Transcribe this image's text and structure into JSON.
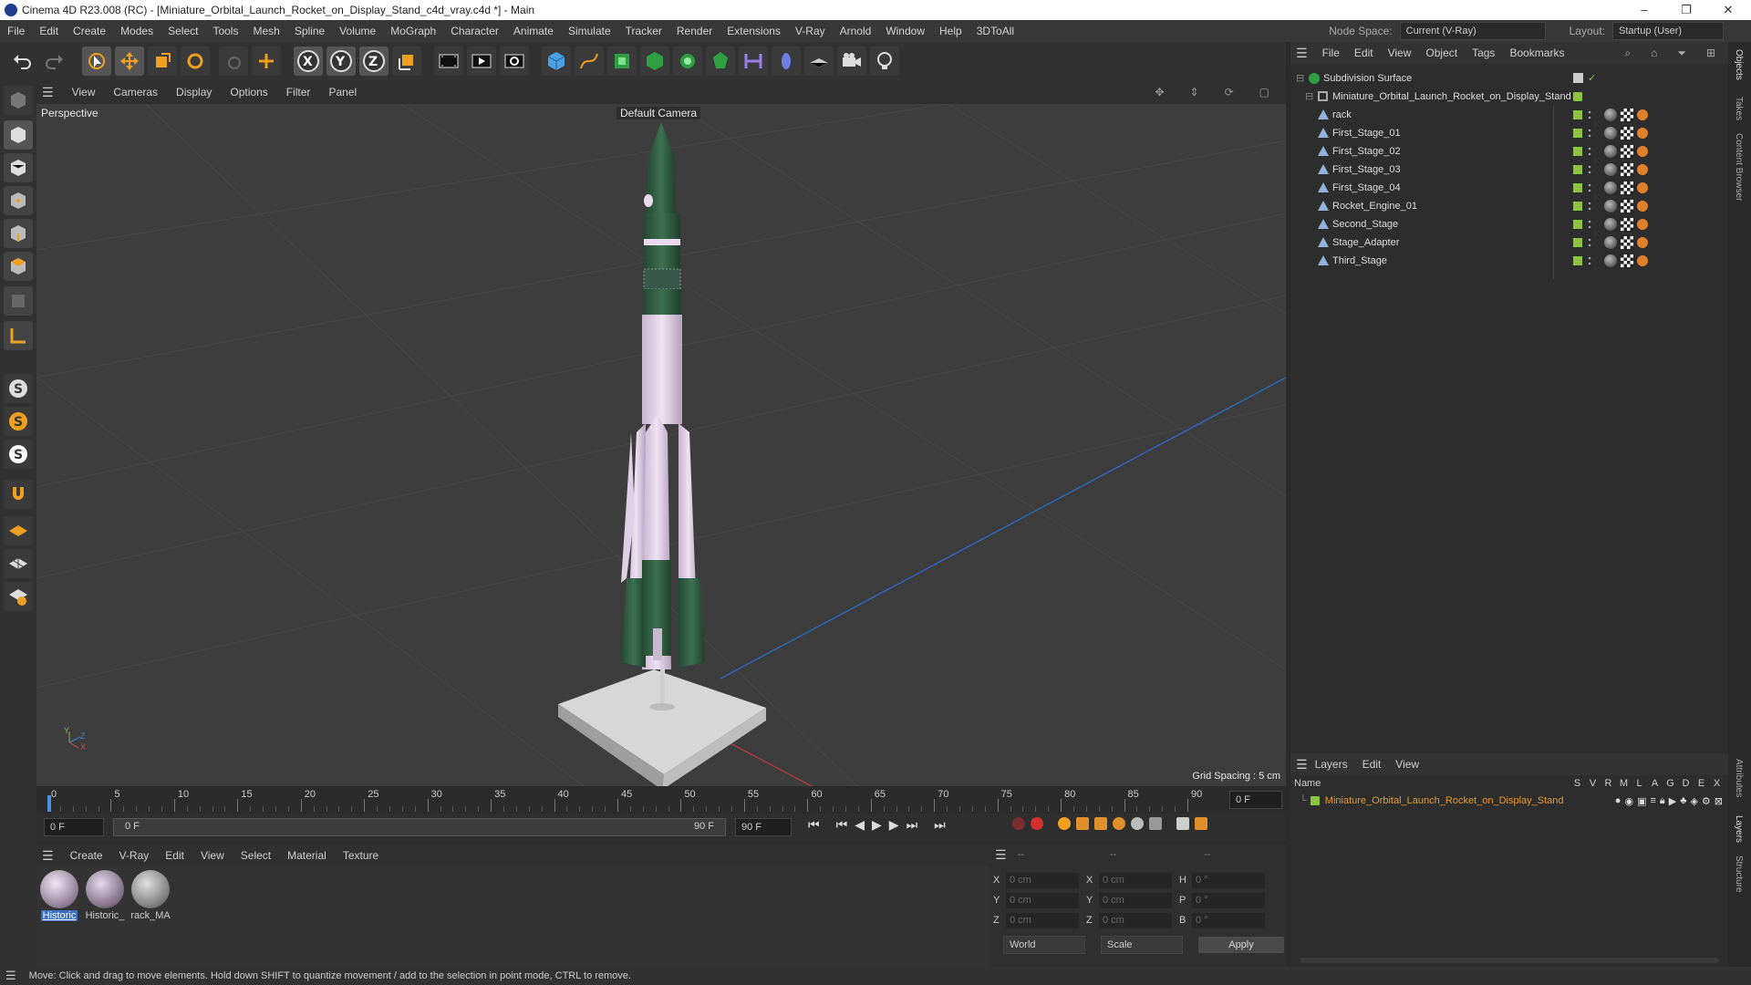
{
  "window": {
    "title": "Cinema 4D R23.008 (RC) - [Miniature_Orbital_Launch_Rocket_on_Display_Stand_c4d_vray.c4d *] - Main",
    "controls": [
      "–",
      "❐",
      "✕"
    ]
  },
  "menubar": {
    "items": [
      "File",
      "Edit",
      "Create",
      "Modes",
      "Select",
      "Tools",
      "Mesh",
      "Spline",
      "Volume",
      "MoGraph",
      "Character",
      "Animate",
      "Simulate",
      "Tracker",
      "Render",
      "Extensions",
      "V-Ray",
      "Arnold",
      "Window",
      "Help",
      "3DToAll"
    ],
    "node_space_label": "Node Space:",
    "node_space_value": "Current (V-Ray)",
    "layout_label": "Layout:",
    "layout_value": "Startup (User)"
  },
  "viewport": {
    "menu": [
      "View",
      "Cameras",
      "Display",
      "Options",
      "Filter",
      "Panel"
    ],
    "projection": "Perspective",
    "camera": "Default Camera",
    "grid_spacing": "Grid Spacing : 5 cm",
    "axis_y": "Y",
    "axis_z": "Z",
    "axis_x": "X"
  },
  "timeline": {
    "ticks": [
      "0",
      "5",
      "10",
      "15",
      "20",
      "25",
      "30",
      "35",
      "40",
      "45",
      "50",
      "55",
      "60",
      "65",
      "70",
      "75",
      "80",
      "85",
      "90"
    ],
    "current_frame": "0 F",
    "start_field": "0 F",
    "range_start": "0 F",
    "range_end": "90 F",
    "end_field": "90 F"
  },
  "materials": {
    "menu": [
      "Create",
      "V-Ray",
      "Edit",
      "View",
      "Select",
      "Material",
      "Texture"
    ],
    "items": [
      {
        "name": "Historic",
        "selected": true
      },
      {
        "name": "Historic_",
        "selected": false
      },
      {
        "name": "rack_MA",
        "selected": false
      }
    ]
  },
  "coords": {
    "headers": [
      "--",
      "--",
      "--"
    ],
    "rows": [
      {
        "a": "X",
        "av": "0 cm",
        "b": "X",
        "bv": "0 cm",
        "c": "H",
        "cv": "0 °"
      },
      {
        "a": "Y",
        "av": "0 cm",
        "b": "Y",
        "bv": "0 cm",
        "c": "P",
        "cv": "0 °"
      },
      {
        "a": "Z",
        "av": "0 cm",
        "b": "Z",
        "bv": "0 cm",
        "c": "B",
        "cv": "0 °"
      }
    ],
    "space": "World",
    "mode": "Scale",
    "apply": "Apply"
  },
  "objects": {
    "menu": [
      "File",
      "Edit",
      "View",
      "Object",
      "Tags",
      "Bookmarks"
    ],
    "root": "Subdivision Surface",
    "group": "Miniature_Orbital_Launch_Rocket_on_Display_Stand",
    "children": [
      "rack",
      "First_Stage_01",
      "First_Stage_02",
      "First_Stage_03",
      "First_Stage_04",
      "Rocket_Engine_01",
      "Second_Stage",
      "Stage_Adapter",
      "Third_Stage"
    ]
  },
  "layers": {
    "menu": [
      "Layers",
      "Edit",
      "View"
    ],
    "name_header": "Name",
    "flags": [
      "S",
      "V",
      "R",
      "M",
      "L",
      "A",
      "G",
      "D",
      "E",
      "X"
    ],
    "layer_name": "Miniature_Orbital_Launch_Rocket_on_Display_Stand"
  },
  "right_tabs": [
    "Objects",
    "Takes",
    "Content Browser",
    "Attributes",
    "Layers",
    "Structure"
  ],
  "status": "Move: Click and drag to move elements. Hold down SHIFT to quantize movement / add to the selection in point mode, CTRL to remove.",
  "colors": {
    "accent": "#8cc63f",
    "layer_orange": "#e59a2b",
    "rocket_green": "#2f5a3c",
    "rocket_pink": "#d9c4e0"
  }
}
